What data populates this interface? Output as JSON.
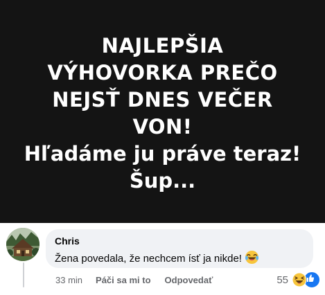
{
  "post": {
    "lines": [
      "NAJLEPŠIA",
      "VÝHOVORKA PREČO",
      "NEJSŤ DNES VEČER",
      "VON!",
      "Hľadáme ju práve teraz!",
      "Šup..."
    ],
    "background_color": "#141414",
    "text_color": "#ffffff"
  },
  "comment": {
    "author": "Chris",
    "text": "Žena povedala, že nechcem ísť ja nikde!",
    "emoji": "laughing-tears-emoji",
    "time": "33 min",
    "like_label": "Páči sa mi to",
    "reply_label": "Odpovedať",
    "reaction_count": "55",
    "reaction_icons": [
      "haha-reaction-icon",
      "like-reaction-icon"
    ]
  },
  "colors": {
    "bubble": "#f0f2f5",
    "secondary_text": "#65676b",
    "like_blue": "#1877f2"
  }
}
